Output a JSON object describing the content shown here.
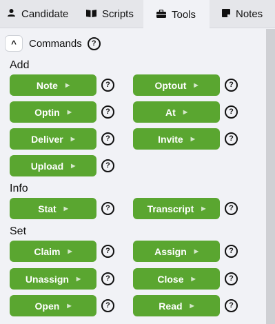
{
  "tabs": [
    {
      "label": "Candidate",
      "icon": "person-icon"
    },
    {
      "label": "Scripts",
      "icon": "book-icon"
    },
    {
      "label": "Tools",
      "icon": "toolbox-icon",
      "active": true
    },
    {
      "label": "Notes",
      "icon": "note-icon"
    }
  ],
  "commands": {
    "toggle_symbol": "^",
    "label": "Commands",
    "help_symbol": "?"
  },
  "sections": [
    {
      "title": "Add",
      "buttons": [
        "Note",
        "Optout",
        "Optin",
        "At",
        "Deliver",
        "Invite",
        "Upload"
      ]
    },
    {
      "title": "Info",
      "buttons": [
        "Stat",
        "Transcript"
      ]
    },
    {
      "title": "Set",
      "buttons": [
        "Claim",
        "Assign",
        "Unassign",
        "Close",
        "Open",
        "Read"
      ]
    }
  ],
  "colors": {
    "button": "#5aa630",
    "background": "#f1f2f6",
    "tabbar": "#e5e6ea"
  }
}
